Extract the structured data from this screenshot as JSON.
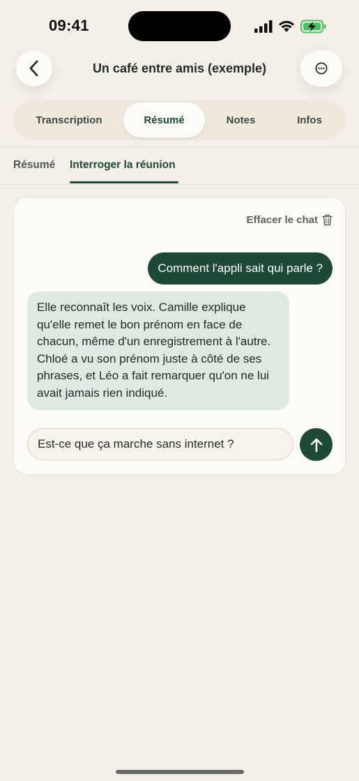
{
  "status_bar": {
    "time": "09:41"
  },
  "header": {
    "title": "Un café entre amis (exemple)",
    "back_icon": "chevron-left-icon",
    "more_icon": "ellipsis-circle-icon"
  },
  "main_tabs": [
    {
      "label": "Transcription",
      "active": false
    },
    {
      "label": "Résumé",
      "active": true
    },
    {
      "label": "Notes",
      "active": false
    },
    {
      "label": "Infos",
      "active": false
    }
  ],
  "sub_tabs": [
    {
      "label": "Résumé",
      "active": false
    },
    {
      "label": "Interroger la réunion",
      "active": true
    }
  ],
  "chat": {
    "clear_label": "Effacer le chat",
    "clear_icon": "trash-icon",
    "messages": [
      {
        "role": "user",
        "text": "Comment l'appli sait qui parle ?"
      },
      {
        "role": "assistant",
        "text": "Elle reconnaît les voix. Camille explique qu'elle remet le bon prénom en face de chacun, même d'un enregistrement à l'autre. Chloé a vu son prénom juste à côté de ses phrases, et Léo a fait remarquer qu'on ne lui avait jamais rien indiqué."
      }
    ],
    "input_value": "Est-ce que ça marche sans internet ?",
    "send_icon": "arrow-up-icon"
  },
  "colors": {
    "accent": "#1c4a37",
    "background": "#f4f0e8",
    "assistant_bubble": "#dde9e1",
    "battery": "#4cc05e"
  }
}
